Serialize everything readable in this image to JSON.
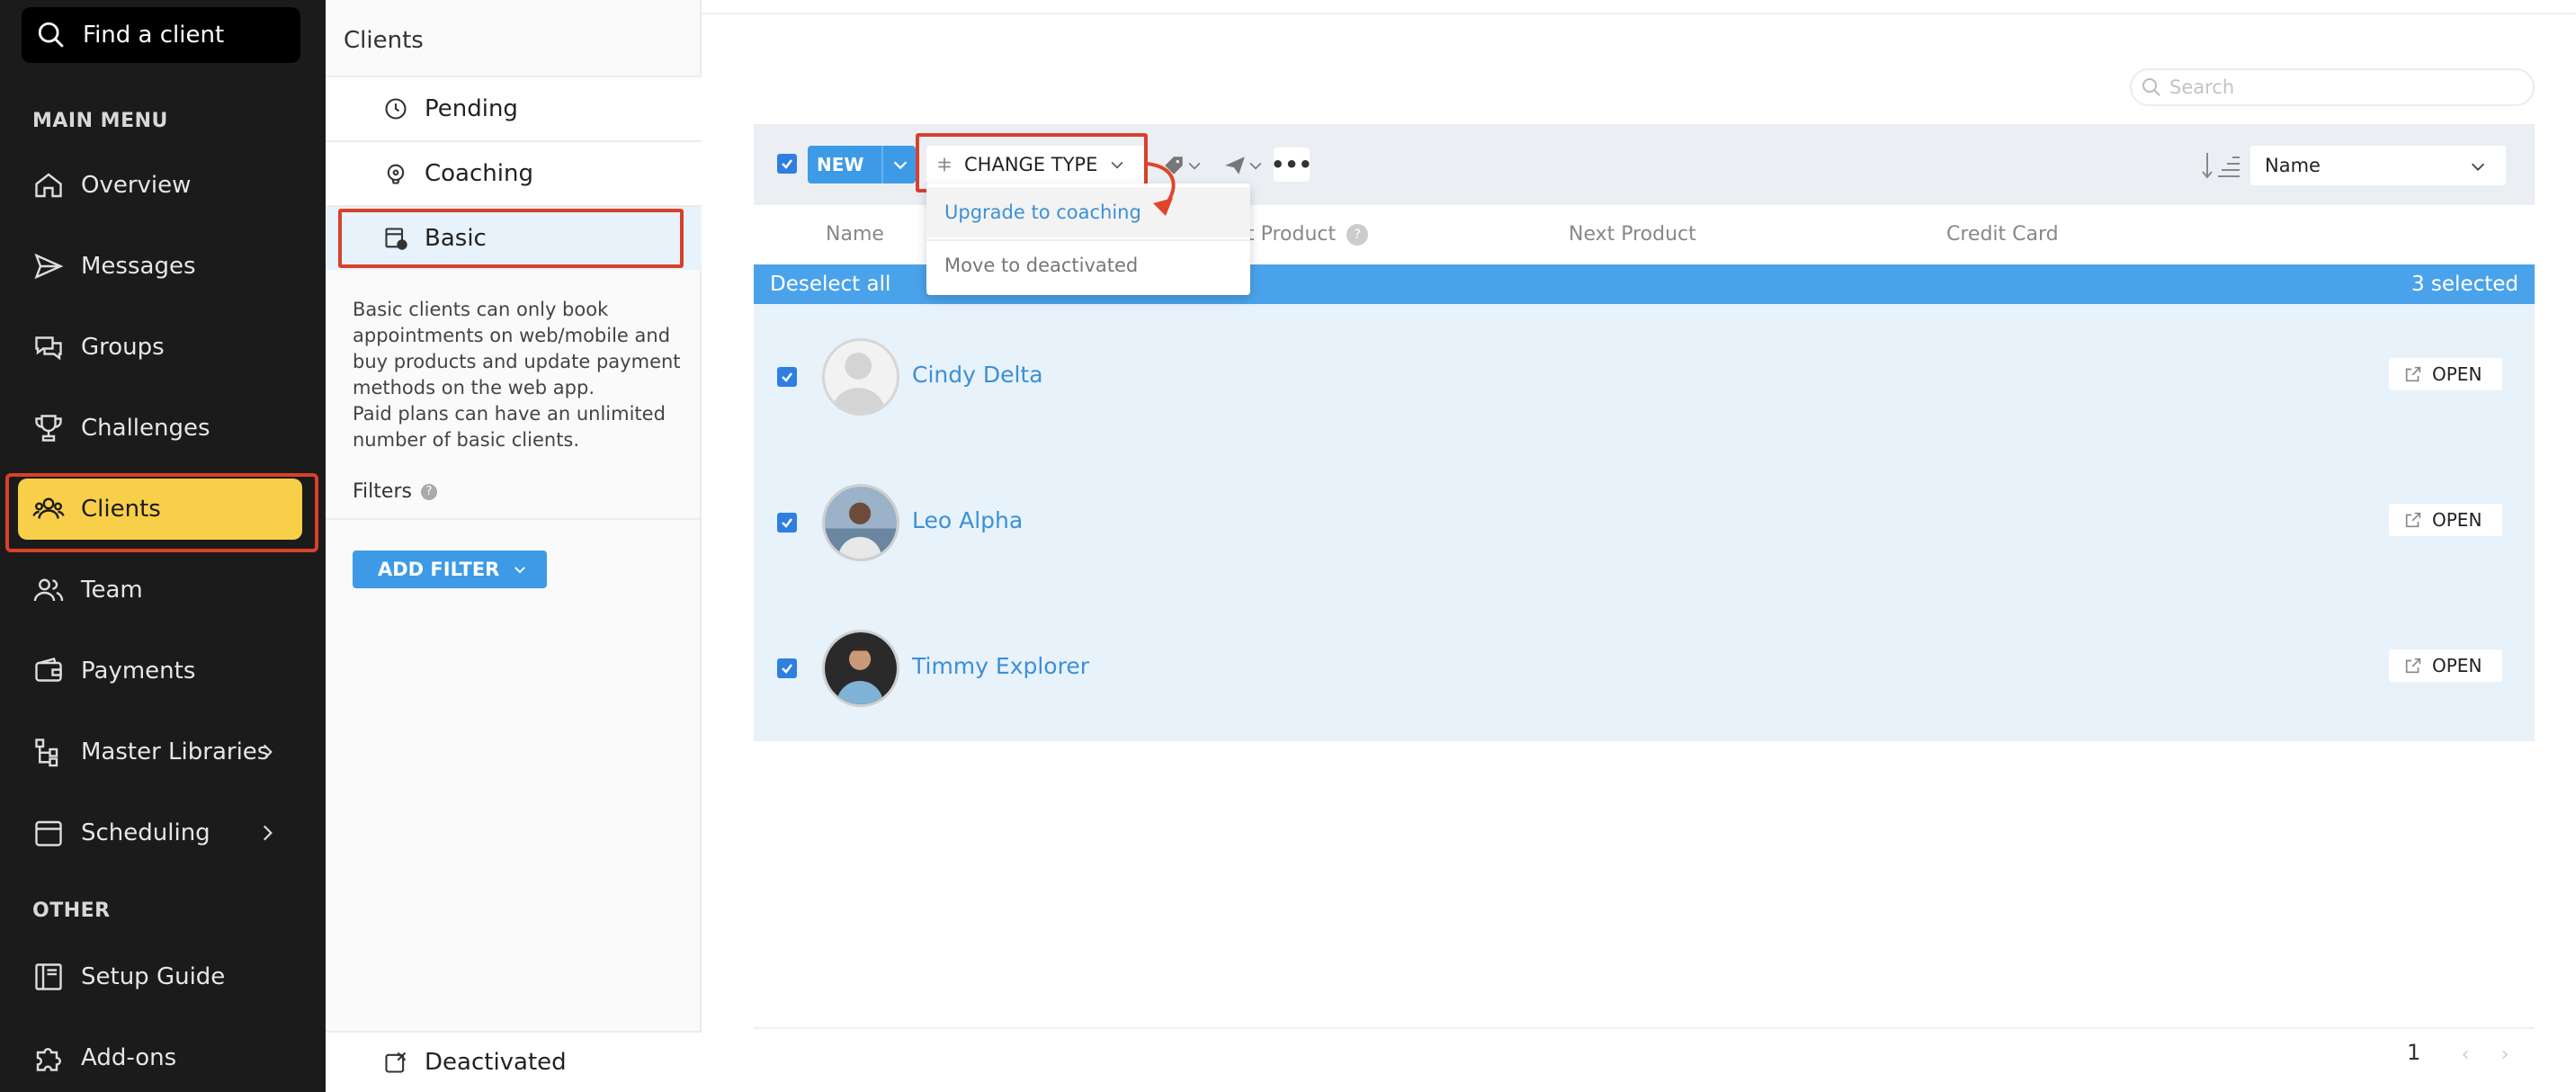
{
  "sidebar": {
    "search_label": "Find a client",
    "main_menu_heading": "MAIN MENU",
    "items": [
      {
        "label": "Overview",
        "icon": "home-icon"
      },
      {
        "label": "Messages",
        "icon": "send-icon"
      },
      {
        "label": "Groups",
        "icon": "chat-icon"
      },
      {
        "label": "Challenges",
        "icon": "trophy-icon"
      },
      {
        "label": "Clients",
        "icon": "users-icon",
        "active": true
      },
      {
        "label": "Team",
        "icon": "team-icon"
      },
      {
        "label": "Payments",
        "icon": "wallet-icon"
      },
      {
        "label": "Master Libraries",
        "icon": "library-icon",
        "has_submenu": true
      },
      {
        "label": "Scheduling",
        "icon": "calendar-icon",
        "has_submenu": true
      }
    ],
    "other_heading": "OTHER",
    "other_items": [
      {
        "label": "Setup Guide",
        "icon": "book-icon"
      },
      {
        "label": "Add-ons",
        "icon": "puzzle-icon"
      }
    ],
    "accent_color": "#f8cf48"
  },
  "clients_panel": {
    "title": "Clients",
    "types": [
      {
        "label": "Pending",
        "icon": "clock-icon"
      },
      {
        "label": "Coaching",
        "icon": "whistle-icon"
      },
      {
        "label": "Basic",
        "icon": "basic-client-icon",
        "selected": true
      }
    ],
    "description": "Basic clients can only book appointments on web/mobile and buy products and update payment methods on the web app.",
    "description_2": "Paid plans can have an unlimited number of basic clients.",
    "filters_label": "Filters",
    "filters_help": "?",
    "add_filter_label": "ADD FILTER",
    "deactivated_label": "Deactivated"
  },
  "main": {
    "search_placeholder": "Search",
    "toolbar": {
      "new_label": "NEW",
      "change_type_label": "CHANGE TYPE",
      "more_label": "•••",
      "sort_value": "Name"
    },
    "dropdown": {
      "items": [
        "Upgrade to coaching",
        "Move to deactivated"
      ]
    },
    "columns": {
      "name": "Name",
      "last_product": "t Product",
      "last_product_help": "?",
      "next_product": "Next Product",
      "credit_card": "Credit Card"
    },
    "selection": {
      "deselect_label": "Deselect all",
      "count_label": "3 selected"
    },
    "clients": [
      {
        "name": "Cindy Delta",
        "open_label": "OPEN"
      },
      {
        "name": "Leo Alpha",
        "open_label": "OPEN"
      },
      {
        "name": "Timmy Explorer",
        "open_label": "OPEN"
      }
    ],
    "pagination": {
      "page": "1",
      "prev": "‹",
      "next": "›"
    }
  }
}
